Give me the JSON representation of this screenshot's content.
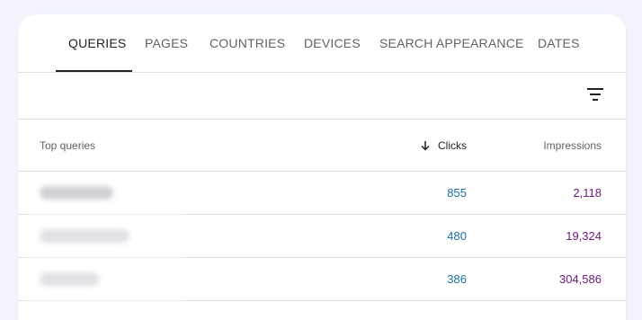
{
  "tabs": [
    {
      "label": "QUERIES",
      "active": true
    },
    {
      "label": "PAGES",
      "active": false
    },
    {
      "label": "COUNTRIES",
      "active": false
    },
    {
      "label": "DEVICES",
      "active": false
    },
    {
      "label": "SEARCH APPEARANCE",
      "active": false
    },
    {
      "label": "DATES",
      "active": false
    }
  ],
  "toolbar": {
    "filter_icon": "filter-icon"
  },
  "table": {
    "headers": {
      "query": "Top queries",
      "clicks": "Clicks",
      "impressions": "Impressions",
      "sort_icon": "arrow-down-icon"
    },
    "rows": [
      {
        "query": "",
        "clicks": "855",
        "impressions": "2,118"
      },
      {
        "query": "",
        "clicks": "480",
        "impressions": "19,324"
      },
      {
        "query": "",
        "clicks": "386",
        "impressions": "304,586"
      }
    ]
  },
  "colors": {
    "clicks": "#1a6fa6",
    "impressions": "#6a1b7b",
    "background": "#f2f3fb"
  }
}
